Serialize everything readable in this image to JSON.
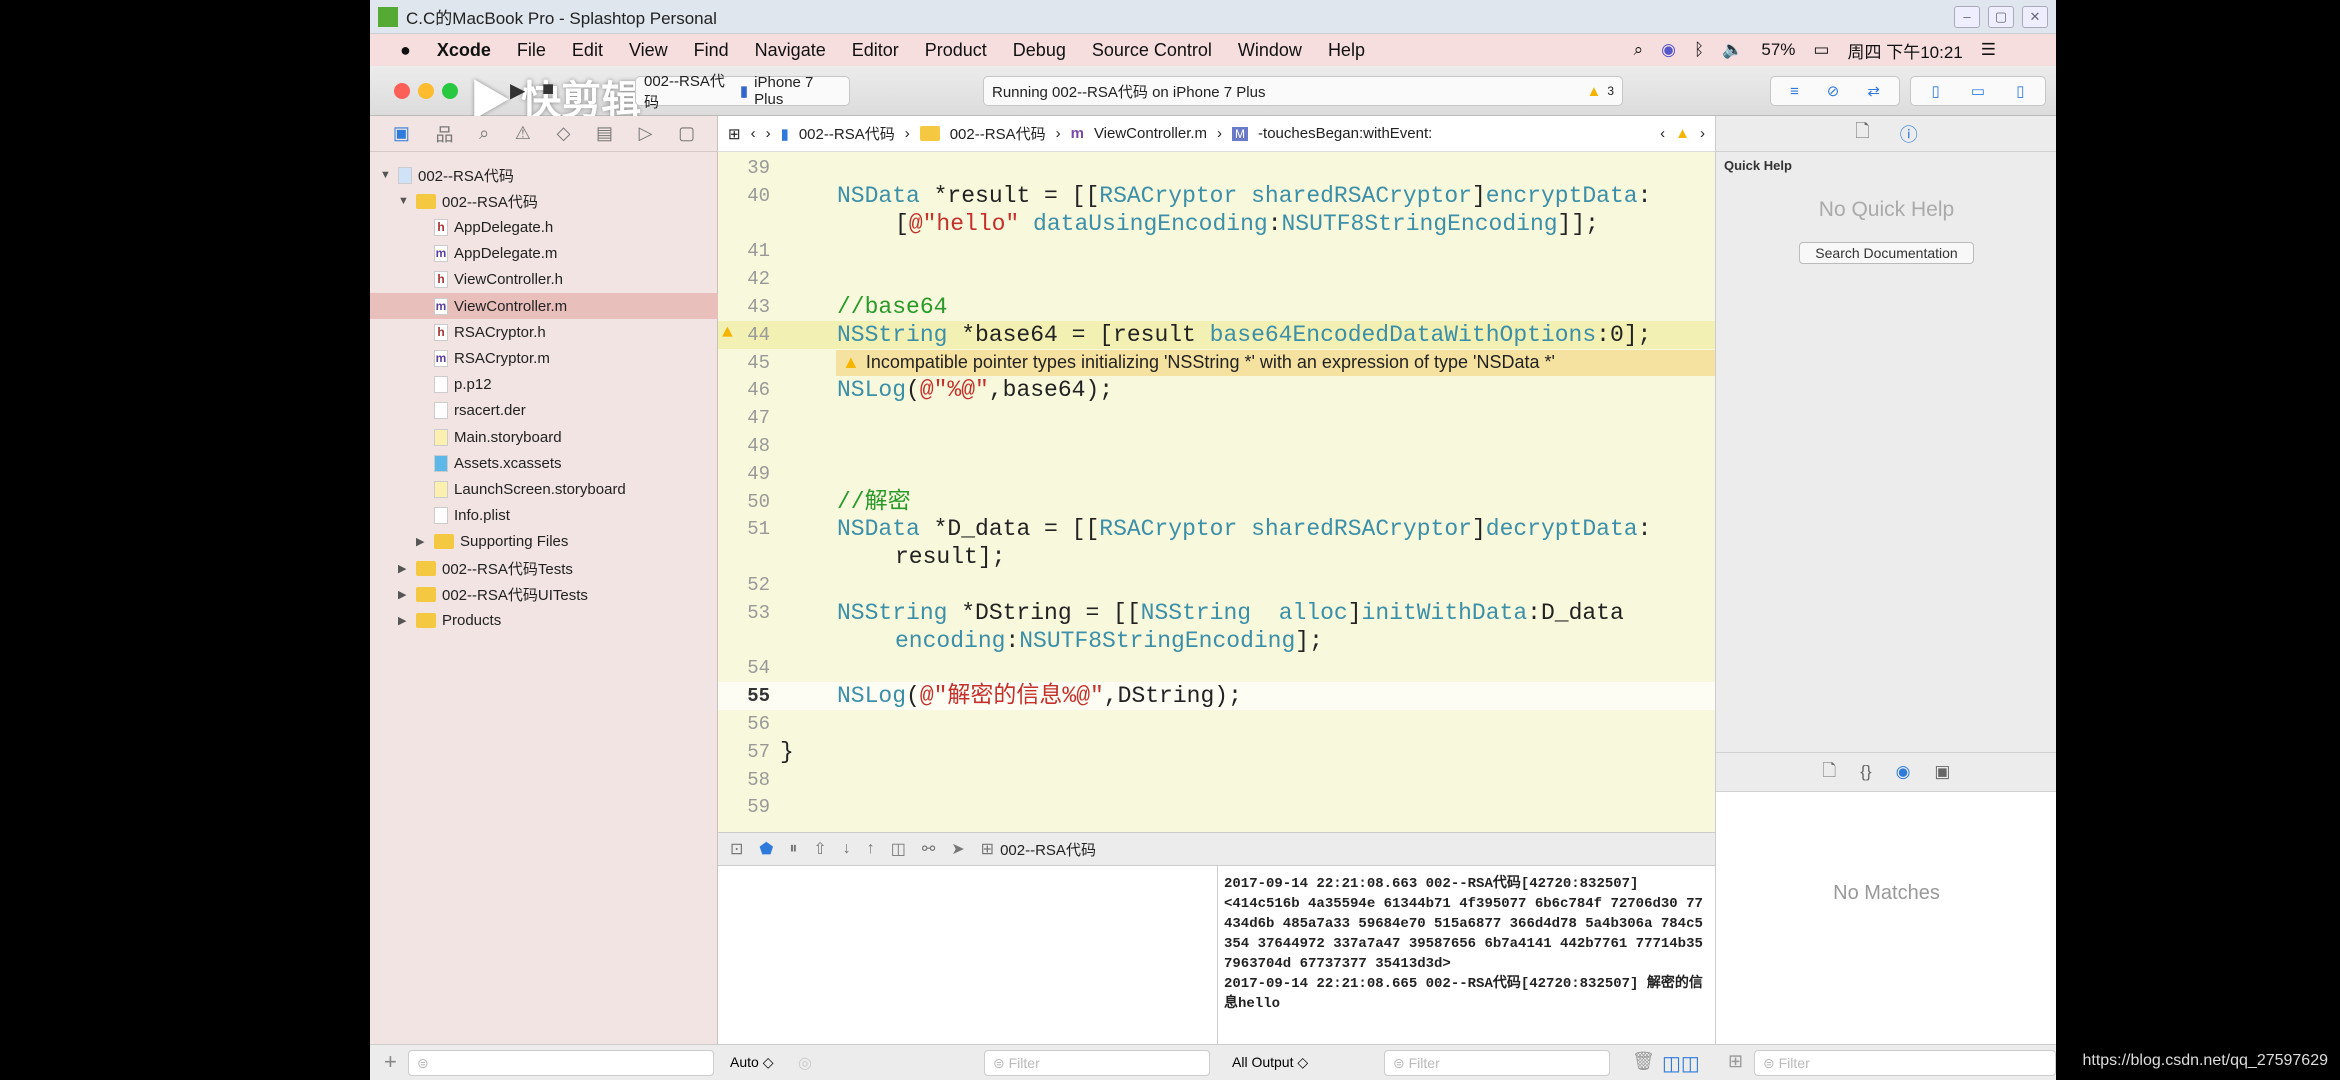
{
  "window": {
    "title": "C.C的MacBook Pro - Splashtop Personal",
    "controls": [
      "–",
      "▢",
      "✕"
    ]
  },
  "menubar": {
    "apple": "",
    "app": "Xcode",
    "items": [
      "File",
      "Edit",
      "View",
      "Find",
      "Navigate",
      "Editor",
      "Product",
      "Debug",
      "Source Control",
      "Window",
      "Help"
    ],
    "battery": "57%",
    "clock": "周四 下午10:21"
  },
  "toolbar": {
    "scheme": "002--RSA代码",
    "device": "iPhone 7 Plus",
    "status": "Running 002--RSA代码 on iPhone 7 Plus",
    "warning_count": "3",
    "watermark": "快剪辑"
  },
  "navigator": {
    "items": [
      {
        "label": "002--RSA代码",
        "kind": "project",
        "depth": 0,
        "disclosure": "▼"
      },
      {
        "label": "002--RSA代码",
        "kind": "folder",
        "depth": 1,
        "disclosure": "▼"
      },
      {
        "label": "AppDelegate.h",
        "kind": "h",
        "depth": 2
      },
      {
        "label": "AppDelegate.m",
        "kind": "m",
        "depth": 2
      },
      {
        "label": "ViewController.h",
        "kind": "h",
        "depth": 2
      },
      {
        "label": "ViewController.m",
        "kind": "m",
        "depth": 2,
        "selected": true
      },
      {
        "label": "RSACryptor.h",
        "kind": "h",
        "depth": 2
      },
      {
        "label": "RSACryptor.m",
        "kind": "m",
        "depth": 2
      },
      {
        "label": "p.p12",
        "kind": "file",
        "depth": 2
      },
      {
        "label": "rsacert.der",
        "kind": "file",
        "depth": 2
      },
      {
        "label": "Main.storyboard",
        "kind": "storyboard",
        "depth": 2
      },
      {
        "label": "Assets.xcassets",
        "kind": "assets",
        "depth": 2
      },
      {
        "label": "LaunchScreen.storyboard",
        "kind": "storyboard",
        "depth": 2
      },
      {
        "label": "Info.plist",
        "kind": "file",
        "depth": 2
      },
      {
        "label": "Supporting Files",
        "kind": "folder",
        "depth": 2,
        "disclosure": "▶"
      },
      {
        "label": "002--RSA代码Tests",
        "kind": "folder",
        "depth": 1,
        "disclosure": "▶"
      },
      {
        "label": "002--RSA代码UITests",
        "kind": "folder",
        "depth": 1,
        "disclosure": "▶"
      },
      {
        "label": "Products",
        "kind": "folder",
        "depth": 1,
        "disclosure": "▶"
      }
    ]
  },
  "jumpbar": {
    "crumbs": [
      "002--RSA代码",
      "002--RSA代码",
      "ViewController.m",
      "-touchesBegan:withEvent:"
    ]
  },
  "editor": {
    "lines": [
      {
        "num": "39",
        "tokens": []
      },
      {
        "num": "40",
        "tokens": [
          [
            "type",
            "NSData"
          ],
          [
            "plain",
            " *result = [["
          ],
          [
            "type",
            "RSACryptor"
          ],
          [
            "plain",
            " "
          ],
          [
            "method",
            "sharedRSACryptor"
          ],
          [
            "plain",
            "]"
          ],
          [
            "method",
            "encryptData"
          ],
          [
            "plain",
            ":"
          ]
        ],
        "cont": [
          [
            "plain",
            "["
          ],
          [
            "str",
            "@\"hello\""
          ],
          [
            "plain",
            " "
          ],
          [
            "method",
            "dataUsingEncoding"
          ],
          [
            "plain",
            ":"
          ],
          [
            "method",
            "NSUTF8StringEncoding"
          ],
          [
            "plain",
            "]];"
          ]
        ]
      },
      {
        "num": "41",
        "tokens": []
      },
      {
        "num": "42",
        "tokens": []
      },
      {
        "num": "43",
        "tokens": [
          [
            "com",
            "//base64"
          ]
        ]
      },
      {
        "num": "44",
        "tokens": [
          [
            "type",
            "NSString"
          ],
          [
            "plain",
            " *base64 = [result "
          ],
          [
            "method",
            "base64EncodedDataWithOptions"
          ],
          [
            "plain",
            ":0];"
          ]
        ],
        "warning": true
      },
      {
        "num": "45",
        "tokens": []
      },
      {
        "num": "46",
        "tokens": [
          [
            "type",
            "NSLog"
          ],
          [
            "plain",
            "("
          ],
          [
            "str",
            "@\"%@\""
          ],
          [
            "plain",
            ",base64);"
          ]
        ]
      },
      {
        "num": "47",
        "tokens": []
      },
      {
        "num": "48",
        "tokens": []
      },
      {
        "num": "49",
        "tokens": []
      },
      {
        "num": "50",
        "tokens": [
          [
            "com",
            "//解密"
          ]
        ]
      },
      {
        "num": "51",
        "tokens": [
          [
            "type",
            "NSData"
          ],
          [
            "plain",
            " *D_data = [["
          ],
          [
            "type",
            "RSACryptor"
          ],
          [
            "plain",
            " "
          ],
          [
            "method",
            "sharedRSACryptor"
          ],
          [
            "plain",
            "]"
          ],
          [
            "method",
            "decryptData"
          ],
          [
            "plain",
            ":"
          ]
        ],
        "cont": [
          [
            "plain",
            "result];"
          ]
        ]
      },
      {
        "num": "52",
        "tokens": []
      },
      {
        "num": "53",
        "tokens": [
          [
            "type",
            "NSString"
          ],
          [
            "plain",
            " *DString = [["
          ],
          [
            "type",
            "NSString"
          ],
          [
            "plain",
            "  "
          ],
          [
            "method",
            "alloc"
          ],
          [
            "plain",
            "]"
          ],
          [
            "method",
            "initWithData"
          ],
          [
            "plain",
            ":D_data"
          ]
        ],
        "cont": [
          [
            "method",
            "encoding"
          ],
          [
            "plain",
            ":"
          ],
          [
            "method",
            "NSUTF8StringEncoding"
          ],
          [
            "plain",
            "];"
          ]
        ]
      },
      {
        "num": "54",
        "tokens": []
      },
      {
        "num": "55",
        "tokens": [
          [
            "type",
            "NSLog"
          ],
          [
            "plain",
            "("
          ],
          [
            "str",
            "@\"解密的信息%@\""
          ],
          [
            "plain",
            ",DString);"
          ]
        ],
        "current": true
      },
      {
        "num": "56",
        "tokens": []
      },
      {
        "num": "57",
        "tokens": [
          [
            "plain",
            "}"
          ]
        ],
        "outdent": true
      },
      {
        "num": "58",
        "tokens": []
      },
      {
        "num": "59",
        "tokens": []
      }
    ],
    "warning_message": "Incompatible pointer types initializing 'NSString *' with an expression of type 'NSData *'"
  },
  "debug": {
    "target": "002--RSA代码",
    "variables_scope": "Auto ◇",
    "output_scope": "All Output ◇",
    "filter_placeholder": "Filter"
  },
  "console": {
    "text": "2017-09-14 22:21:08.663 002--RSA代码[42720:832507]\n<414c516b 4a35594e 61344b71 4f395077 6b6c784f 72706d30 77434d6b 485a7a33 59684e70 515a6877 366d4d78 5a4b306a 784c5354 37644972 337a7a47 39587656 6b7a4141 442b7761 77714b35 7963704d 67737377 35413d3d>\n2017-09-14 22:21:08.665 002--RSA代码[42720:832507] 解密的信息hello"
  },
  "inspector": {
    "section": "Quick Help",
    "empty": "No Quick Help",
    "search_button": "Search Documentation",
    "library_empty": "No Matches"
  },
  "watermark_url": "https://blog.csdn.net/qq_27597629",
  "colors": {
    "editor_bg": "#f8f8dc",
    "warning": "#f5b400",
    "selection": "#e9bfbc",
    "accent": "#2f7bdc"
  }
}
